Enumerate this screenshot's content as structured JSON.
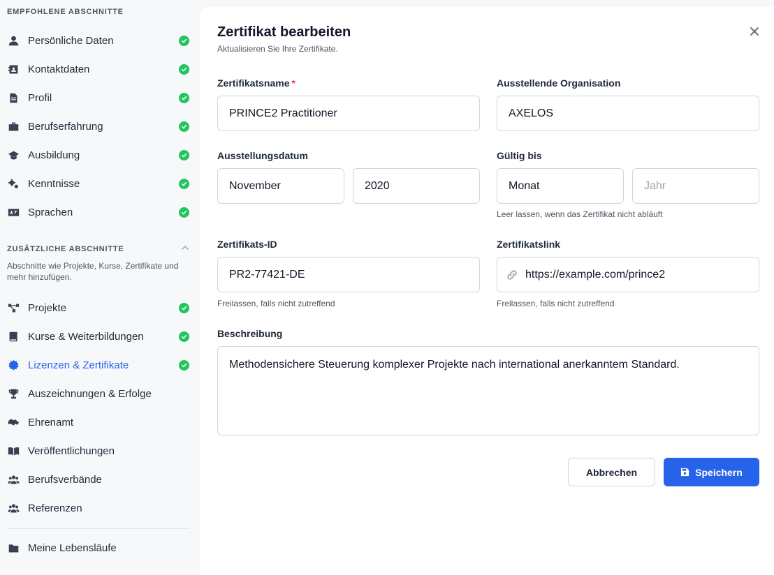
{
  "sidebar": {
    "recommended_title": "EMPFOHLENE ABSCHNITTE",
    "recommended": [
      {
        "label": "Persönliche Daten",
        "icon": "user-icon",
        "done": true
      },
      {
        "label": "Kontaktdaten",
        "icon": "contact-card-icon",
        "done": true
      },
      {
        "label": "Profil",
        "icon": "document-icon",
        "done": true
      },
      {
        "label": "Berufserfahrung",
        "icon": "briefcase-icon",
        "done": true
      },
      {
        "label": "Ausbildung",
        "icon": "graduation-cap-icon",
        "done": true
      },
      {
        "label": "Kenntnisse",
        "icon": "cogs-icon",
        "done": true
      },
      {
        "label": "Sprachen",
        "icon": "language-icon",
        "done": true
      }
    ],
    "additional_title": "ZUSÄTZLICHE ABSCHNITTE",
    "additional_desc": "Abschnitte wie Projekte, Kurse, Zertifikate und mehr hinzufügen.",
    "additional": [
      {
        "label": "Projekte",
        "icon": "project-diagram-icon",
        "done": true
      },
      {
        "label": "Kurse & Weiterbildungen",
        "icon": "book-icon",
        "done": true
      },
      {
        "label": "Lizenzen & Zertifikate",
        "icon": "certificate-icon",
        "done": true,
        "active": true
      },
      {
        "label": "Auszeichnungen & Erfolge",
        "icon": "trophy-icon",
        "done": false
      },
      {
        "label": "Ehrenamt",
        "icon": "handshake-icon",
        "done": false
      },
      {
        "label": "Veröffentlichungen",
        "icon": "book-open-icon",
        "done": false
      },
      {
        "label": "Berufsverbände",
        "icon": "users-icon",
        "done": false
      },
      {
        "label": "Referenzen",
        "icon": "users-icon",
        "done": false
      }
    ],
    "footer": {
      "label": "Meine Lebensläufe",
      "icon": "folder-icon"
    }
  },
  "form": {
    "title": "Zertifikat bearbeiten",
    "subtitle": "Aktualisieren Sie Ihre Zertifikate.",
    "name_label": "Zertifikatsname",
    "required_mark": "*",
    "name_value": "PRINCE2 Practitioner",
    "org_label": "Ausstellende Organisation",
    "org_value": "AXELOS",
    "issue_label": "Ausstellungsdatum",
    "issue_month": "November",
    "issue_year": "2020",
    "valid_label": "Gültig bis",
    "valid_month": "Monat",
    "valid_year_placeholder": "Jahr",
    "valid_hint": "Leer lassen, wenn das Zertifikat nicht abläuft",
    "id_label": "Zertifikats-ID",
    "id_value": "PR2-77421-DE",
    "id_hint": "Freilassen, falls nicht zutreffend",
    "link_label": "Zertifikatslink",
    "link_value": "https://example.com/prince2",
    "link_hint": "Freilassen, falls nicht zutreffend",
    "desc_label": "Beschreibung",
    "desc_value": "Methodensichere Steuerung komplexer Projekte nach international anerkanntem Standard.",
    "cancel_label": "Abbrechen",
    "save_label": "Speichern"
  },
  "colors": {
    "accent": "#2563eb",
    "success": "#22c55e",
    "required": "#ef4444"
  }
}
